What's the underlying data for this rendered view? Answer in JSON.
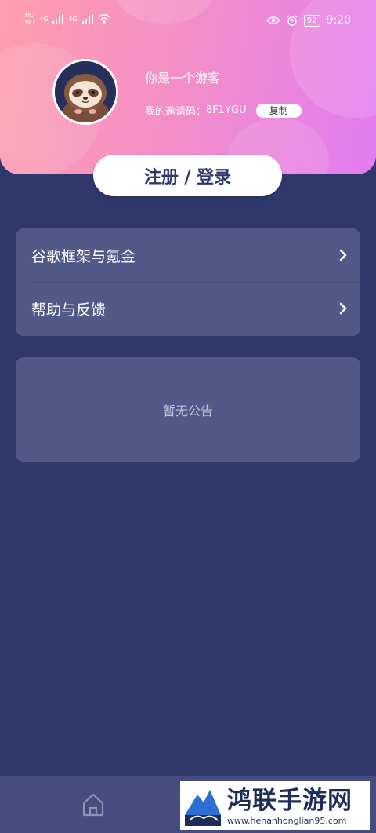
{
  "status_bar": {
    "left_indicators": [
      "HD",
      "HD",
      "4G",
      "4G"
    ],
    "battery": "92",
    "time": "9:20",
    "icons": [
      "signal-icon",
      "wifi-icon",
      "eye-icon",
      "alarm-icon",
      "battery-icon"
    ]
  },
  "profile": {
    "title": "你是一个游客",
    "invite_label": "我的邀请码：",
    "invite_code": "8F1YGU",
    "copy_label": "复制",
    "avatar_icon": "sloth-avatar"
  },
  "login_button": "注册 / 登录",
  "menu": {
    "items": [
      {
        "label": "谷歌框架与氪金",
        "icon": "chevron-right-icon"
      },
      {
        "label": "帮助与反馈",
        "icon": "chevron-right-icon"
      }
    ]
  },
  "notice": {
    "text": "暂无公告"
  },
  "bottom_nav": {
    "icons": [
      "home-icon"
    ]
  },
  "watermark": {
    "title": "鸿联手游网",
    "url": "www.henanhonglian95.com"
  },
  "colors": {
    "background": "#2f386b",
    "card": "#515988",
    "header_gradient_start": "#ff9eae",
    "header_gradient_end": "#e27cf2"
  }
}
